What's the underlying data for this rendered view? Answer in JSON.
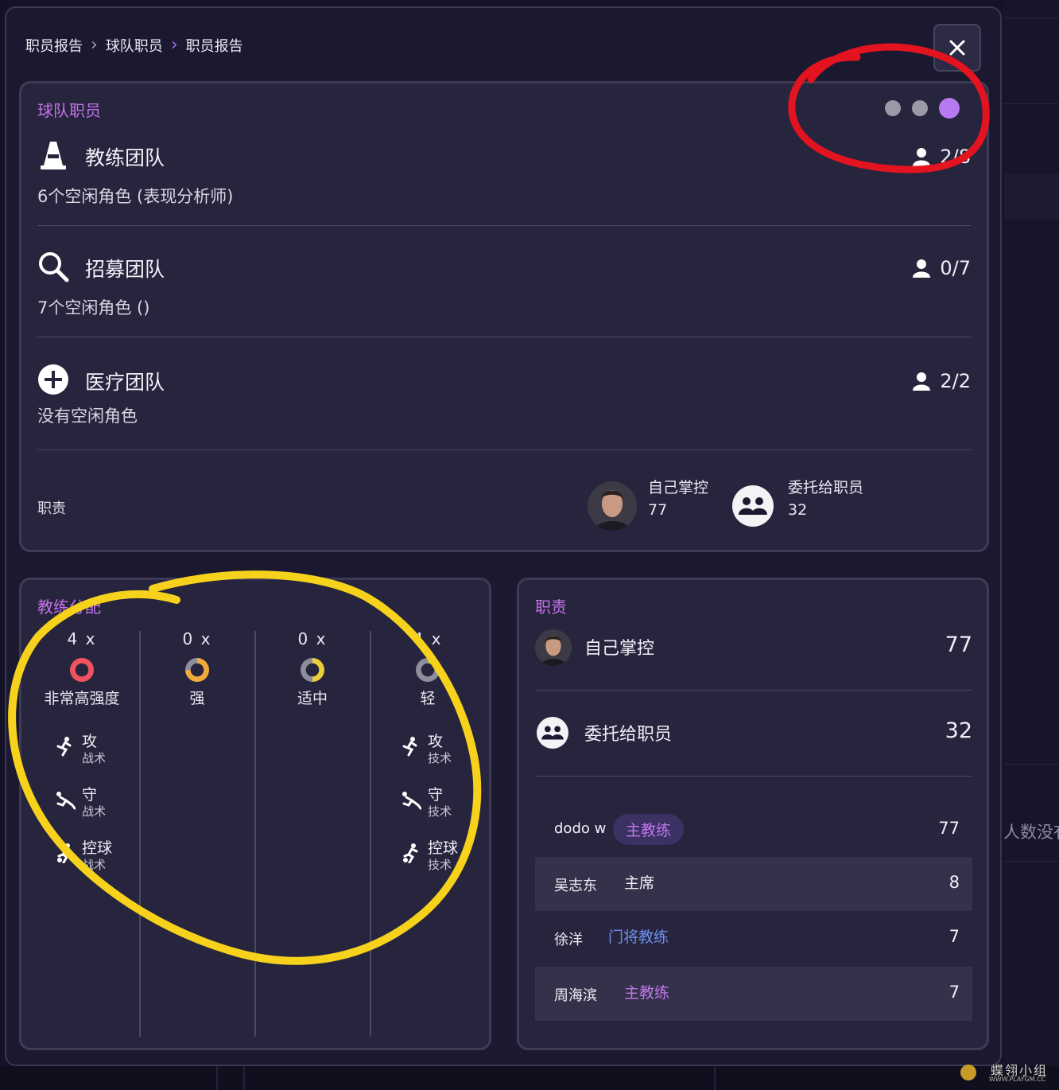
{
  "breadcrumb": [
    "职员报告",
    "球队职员",
    "职员报告"
  ],
  "close_label": "✕",
  "team_panel": {
    "title": "球队职员",
    "page_dots": 3,
    "active_dot": 3,
    "teams": [
      {
        "name": "教练团队",
        "subtitle": "6个空闲角色 (表现分析师)",
        "count": "2/8",
        "icon": "cone-icon"
      },
      {
        "name": "招募团队",
        "subtitle": "7个空闲角色 ()",
        "count": "0/7",
        "icon": "search-icon"
      },
      {
        "name": "医疗团队",
        "subtitle": "没有空闲角色",
        "count": "2/2",
        "icon": "medical-plus-icon"
      }
    ],
    "duty": {
      "label": "职责",
      "self": {
        "label": "自己掌控",
        "value": "77"
      },
      "delegated": {
        "label": "委托给职员",
        "value": "32"
      }
    }
  },
  "training": {
    "title": "教练分配",
    "columns": [
      {
        "count": "4 x",
        "label": "非常高强度",
        "ring_color": "#f0535f",
        "fill_fraction": 1.0
      },
      {
        "count": "0 x",
        "label": "强",
        "ring_color": "#f2a93b",
        "fill_fraction": 0.75
      },
      {
        "count": "0 x",
        "label": "适中",
        "ring_color": "#e8cf3a",
        "fill_fraction": 0.5
      },
      {
        "count": "4 x",
        "label": "轻",
        "ring_color": "#9ccf3a",
        "fill_fraction": 0.25
      }
    ],
    "skills_left": [
      {
        "title": "攻",
        "sub": "战术",
        "icon": "attack-icon"
      },
      {
        "title": "守",
        "sub": "战术",
        "icon": "defend-icon"
      },
      {
        "title": "控球",
        "sub": "战术",
        "icon": "possession-icon"
      }
    ],
    "skills_right": [
      {
        "title": "攻",
        "sub": "技术",
        "icon": "attack-icon"
      },
      {
        "title": "守",
        "sub": "技术",
        "icon": "defend-icon"
      },
      {
        "title": "控球",
        "sub": "技术",
        "icon": "possession-icon"
      }
    ]
  },
  "responsibility": {
    "title": "职责",
    "self": {
      "label": "自己掌控",
      "value": "77"
    },
    "delegated": {
      "label": "委托给职员",
      "value": "32"
    },
    "staff": [
      {
        "name": "dodo w",
        "role": "主教练",
        "value": "77",
        "role_color": "#c077ec"
      },
      {
        "name": "吴志东",
        "role": "主席",
        "value": "8",
        "role_color": "#f0eff6"
      },
      {
        "name": "徐洋",
        "role": "门将教练",
        "value": "7",
        "role_color": "#6d8ef0"
      },
      {
        "name": "周海滨",
        "role": "主教练",
        "value": "7",
        "role_color": "#c077ec"
      }
    ]
  },
  "background": {
    "partial_text": "人数没有"
  },
  "watermark": {
    "text": "蝶翎小组",
    "url": "WWW.PLAYGM.CC"
  },
  "colors": {
    "accent": "#c372e8",
    "annotation_red": "#e3141f",
    "annotation_yellow": "#f7d21c"
  }
}
